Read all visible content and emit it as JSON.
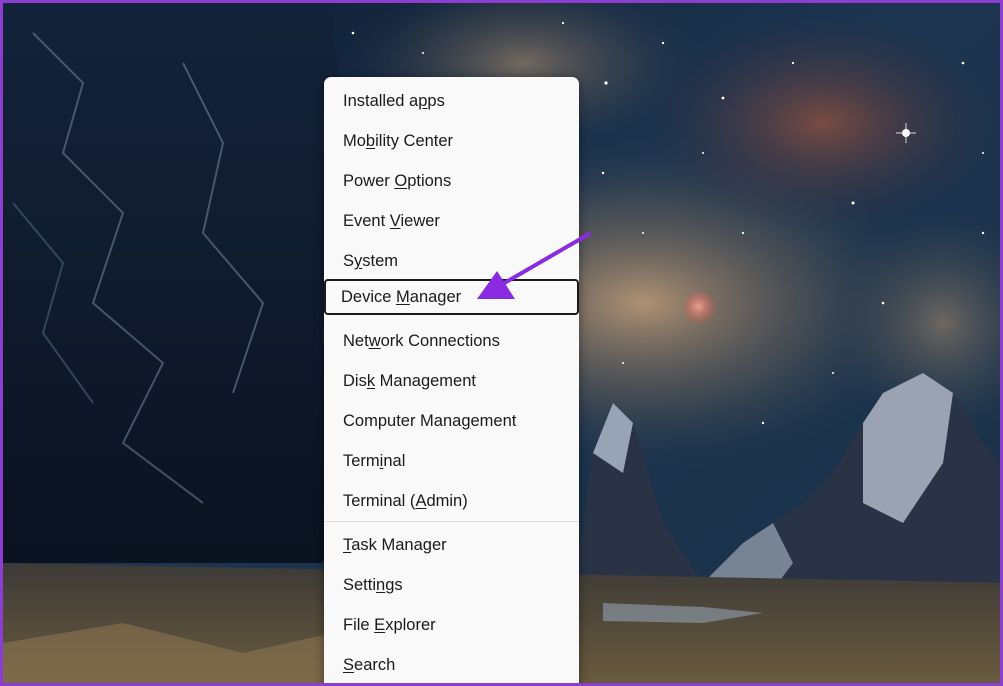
{
  "context_menu": {
    "items": [
      {
        "pre": "Installed a",
        "key": "p",
        "post": "ps"
      },
      {
        "pre": "Mo",
        "key": "b",
        "post": "ility Center"
      },
      {
        "pre": "Power ",
        "key": "O",
        "post": "ptions"
      },
      {
        "pre": "Event ",
        "key": "V",
        "post": "iewer"
      },
      {
        "pre": "S",
        "key": "y",
        "post": "stem"
      },
      {
        "pre": "Device ",
        "key": "M",
        "post": "anager"
      },
      {
        "pre": "Net",
        "key": "w",
        "post": "ork Connections"
      },
      {
        "pre": "Dis",
        "key": "k",
        "post": " Management"
      },
      {
        "pre": "Computer Mana",
        "key": "g",
        "post": "ement"
      },
      {
        "pre": "Term",
        "key": "i",
        "post": "nal"
      },
      {
        "pre": "Terminal (",
        "key": "A",
        "post": "dmin)"
      },
      {
        "pre": "",
        "key": "T",
        "post": "ask Manager"
      },
      {
        "pre": "Setti",
        "key": "n",
        "post": "gs"
      },
      {
        "pre": "File ",
        "key": "E",
        "post": "xplorer"
      },
      {
        "pre": "",
        "key": "S",
        "post": "earch"
      }
    ],
    "focused_item": "Device Manager"
  },
  "colors": {
    "frame_border": "#8a3fd0",
    "annotation_arrow": "#8a2be2",
    "menu_background": "#f9f9f9",
    "menu_text": "#1b1b1b"
  },
  "icons": {
    "annotation": "arrow-pointer-icon"
  }
}
